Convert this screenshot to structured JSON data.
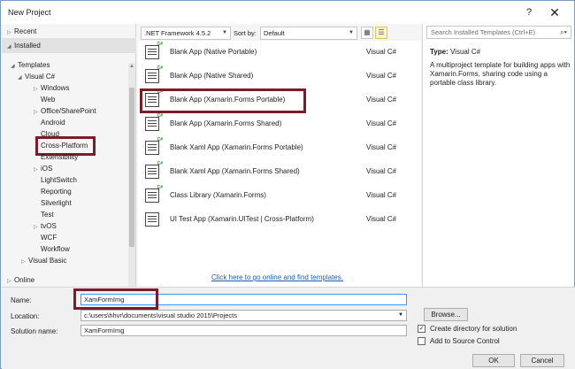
{
  "window": {
    "title": "New Project",
    "help": "?",
    "close": "✕"
  },
  "tree": {
    "recent": "Recent",
    "installed": "Installed",
    "templates": "Templates",
    "visual_csharp": "Visual C#",
    "items": [
      "Windows",
      "Web",
      "Office/SharePoint",
      "Android",
      "Cloud",
      "Cross-Platform",
      "Extensibility",
      "iOS",
      "LightSwitch",
      "Reporting",
      "Silverlight",
      "Test",
      "tvOS",
      "WCF",
      "Workflow"
    ],
    "visual_basic": "Visual Basic",
    "online": "Online"
  },
  "toolbar": {
    "framework": ".NET Framework 4.5.2",
    "sort_label": "Sort by:",
    "sort_value": "Default"
  },
  "templates": [
    {
      "name": "Blank App (Native Portable)",
      "lang": "Visual C#"
    },
    {
      "name": "Blank App (Native Shared)",
      "lang": "Visual C#"
    },
    {
      "name": "Blank App (Xamarin.Forms Portable)",
      "lang": "Visual C#"
    },
    {
      "name": "Blank App (Xamarin.Forms Shared)",
      "lang": "Visual C#"
    },
    {
      "name": "Blank Xaml App (Xamarin.Forms Portable)",
      "lang": "Visual C#"
    },
    {
      "name": "Blank Xaml App (Xamarin.Forms Shared)",
      "lang": "Visual C#"
    },
    {
      "name": "Class Library (Xamarin.Forms)",
      "lang": "Visual C#"
    },
    {
      "name": "UI Test App (Xamarin.UITest | Cross-Platform)",
      "lang": "Visual C#"
    }
  ],
  "online_link": "Click here to go online and find templates.",
  "details": {
    "search_placeholder": "Search Installed Templates (Ctrl+E)",
    "type_label": "Type:",
    "type_value": "Visual C#",
    "description": "A multiproject template for building apps with Xamarin.Forms, sharing code using a portable class library."
  },
  "form": {
    "name_label": "Name:",
    "name_value": "XamFormImg",
    "location_label": "Location:",
    "location_value": "c:\\users\\hhvr\\documents\\visual studio 2015\\Projects",
    "solution_label": "Solution name:",
    "solution_value": "XamFormImg",
    "browse": "Browse...",
    "create_dir": "Create directory for solution",
    "add_source": "Add to Source Control",
    "ok": "OK",
    "cancel": "Cancel"
  },
  "colors": {
    "highlight": "#7b1c2b",
    "link": "#1a5fb4"
  }
}
